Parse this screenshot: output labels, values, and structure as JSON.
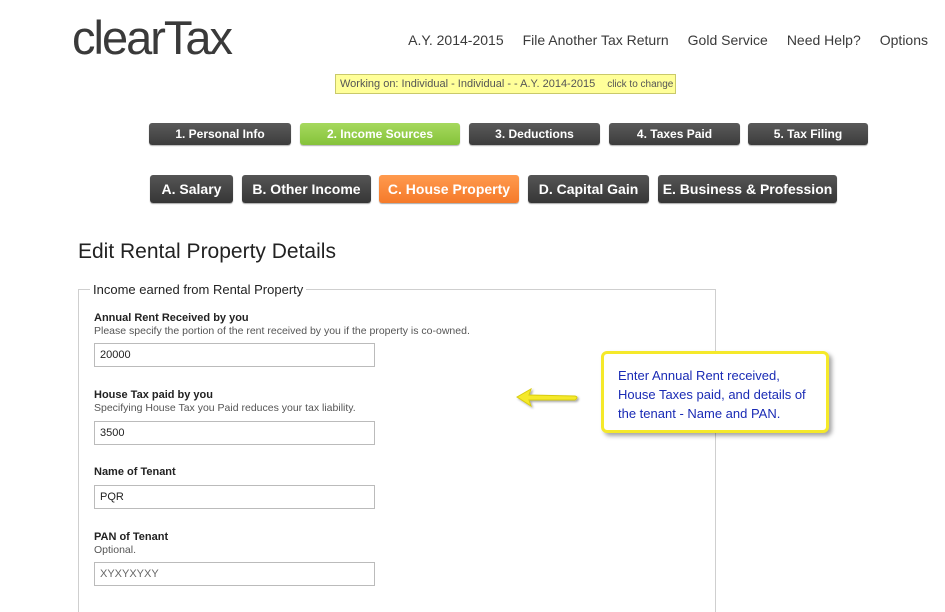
{
  "logo": {
    "text": "clearTax"
  },
  "topnav": {
    "items": [
      {
        "label": "A.Y. 2014-2015"
      },
      {
        "label": "File Another Tax Return"
      },
      {
        "label": "Gold Service"
      },
      {
        "label": "Need Help?"
      },
      {
        "label": "Options"
      }
    ]
  },
  "working": {
    "text": "Working on: Individual - Individual - - A.Y. 2014-2015",
    "change_label": "click to change"
  },
  "steps": [
    {
      "label": "1. Personal Info"
    },
    {
      "label": "2. Income Sources"
    },
    {
      "label": "3. Deductions"
    },
    {
      "label": "4. Taxes Paid"
    },
    {
      "label": "5. Tax Filing"
    }
  ],
  "subtabs": [
    {
      "label": "A. Salary"
    },
    {
      "label": "B. Other Income"
    },
    {
      "label": "C. House Property"
    },
    {
      "label": "D. Capital Gain"
    },
    {
      "label": "E. Business & Profession"
    }
  ],
  "page": {
    "title": "Edit Rental Property Details"
  },
  "form": {
    "legend": "Income earned from Rental Property",
    "annual_rent": {
      "label": "Annual Rent Received by you",
      "help": "Please specify the portion of the rent received by you if the property is co-owned.",
      "value": "20000"
    },
    "house_tax": {
      "label": "House Tax paid by you",
      "help": "Specifying House Tax you Paid reduces your tax liability.",
      "value": "3500"
    },
    "tenant_name": {
      "label": "Name of Tenant",
      "value": "PQR"
    },
    "tenant_pan": {
      "label": "PAN of Tenant",
      "help": "Optional.",
      "placeholder": "XYXYXYXY"
    }
  },
  "callout": {
    "text": "Enter Annual Rent received, House Taxes paid, and details of the tenant - Name and PAN."
  },
  "colors": {
    "active_step": "#94cc48",
    "active_subtab": "#f78a3a",
    "callout_border": "#f5e92a",
    "callout_text": "#1a2bb5"
  },
  "icons": {
    "arrow": "arrow-left-icon"
  }
}
